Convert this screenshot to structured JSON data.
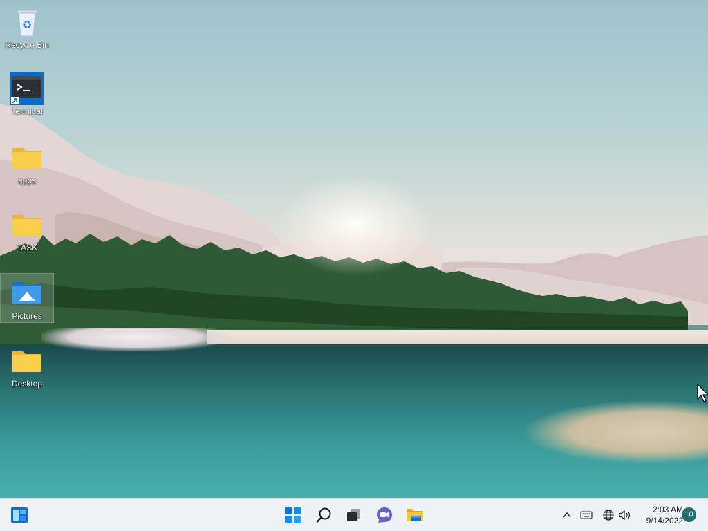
{
  "desktop": {
    "icons": [
      {
        "label": "Recycle Bin",
        "icon": "recycle-bin-icon"
      },
      {
        "label": "Terminal",
        "icon": "terminal-icon",
        "shortcut": true
      },
      {
        "label": "apps",
        "icon": "folder-icon"
      },
      {
        "label": "TASK",
        "icon": "folder-icon"
      },
      {
        "label": "Pictures",
        "icon": "pictures-folder-icon",
        "selected": true
      },
      {
        "label": "Desktop",
        "icon": "folder-icon"
      }
    ]
  },
  "taskbar": {
    "widgets_icon": "widgets-icon",
    "pinned": [
      {
        "name": "start",
        "icon": "windows-start-icon"
      },
      {
        "name": "search",
        "icon": "search-icon"
      },
      {
        "name": "task-view",
        "icon": "task-view-icon"
      },
      {
        "name": "chat",
        "icon": "teams-chat-icon"
      },
      {
        "name": "file-explorer",
        "icon": "file-explorer-icon"
      }
    ],
    "tray": {
      "icons": [
        "chevron-up-icon",
        "keyboard-icon",
        "network-icon",
        "volume-icon"
      ],
      "time": "2:03 AM",
      "date": "9/14/2022",
      "notification_count": "10"
    }
  },
  "colors": {
    "taskbar_bg": "#eef1f6",
    "windows_blue": "#0078d4",
    "folder_yellow": "#f8cf4a",
    "badge": "#1f6e72"
  }
}
